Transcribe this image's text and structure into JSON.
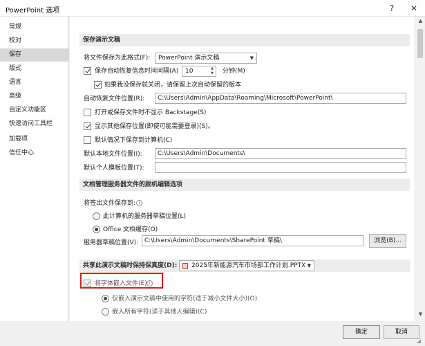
{
  "window": {
    "title": "PowerPoint 选项",
    "help": "?",
    "close": "✕"
  },
  "sidebar": {
    "items": [
      {
        "label": "常规"
      },
      {
        "label": "校对"
      },
      {
        "label": "保存"
      },
      {
        "label": "版式"
      },
      {
        "label": "语言"
      },
      {
        "label": "高级"
      },
      {
        "label": "自定义功能区"
      },
      {
        "label": "快速访问工具栏"
      },
      {
        "label": "加载项"
      },
      {
        "label": "信任中心"
      }
    ],
    "active": "保存"
  },
  "save_section": {
    "header": "保存演示文稿",
    "format_label": "将文件保存为此格式(F):",
    "format_value": "PowerPoint 演示文稿",
    "autorecover_label": "保存自动恢复信息时间间隔(A)",
    "autorecover_minutes": "10",
    "minutes_unit": "分钟(M)",
    "keep_last_label": "如果我没保存就关闭，请保留上次自动保留的版本",
    "autorecover_location_label": "自动恢复文件位置(R):",
    "autorecover_location_value": "C:\\Users\\Admin\\AppData\\Roaming\\Microsoft\\PowerPoint\\",
    "no_backstage_label": "打开或保存文件时不显示 Backstage(S)",
    "show_additional_label": "显示其他保存位置(即使可能需要登录)(S)。",
    "save_to_computer_label": "默认情况下保存到计算机(C)",
    "default_local_label": "默认本地文件位置(I):",
    "default_local_value": "C:\\Users\\Admin\\Documents\\",
    "personal_templates_label": "默认个人模板位置(T):",
    "personal_templates_value": ""
  },
  "offline_section": {
    "header": "文档管理服务器文件的脱机编辑选项",
    "save_checked_out_label": "将签出文件保存到:",
    "option_server_drafts": "此计算机的服务器草稿位置(L)",
    "option_office_cache": "Office 文档缓存(O)",
    "server_drafts_label": "服务器草稿位置(V):",
    "server_drafts_value": "C:\\Users\\Admin\\Documents\\SharePoint 草稿\\",
    "browse_label": "浏览(B)..."
  },
  "fidelity_section": {
    "header": "共享此演示文稿时保持保真度(D):",
    "file_value": "2025年新能源汽车市场部工作计划.PPTX",
    "embed_fonts_label": "将字体嵌入文件(E)",
    "embed_used_only": "仅嵌入演示文稿中使用的字符(适于减小文件大小)(O)",
    "embed_all": "嵌入所有字符(适于其他人编辑)(C)"
  },
  "footer": {
    "ok": "确定",
    "cancel": "取消"
  },
  "colors": {
    "highlight_box": "#d12020",
    "active_sidebar": "#d9d9d9"
  }
}
